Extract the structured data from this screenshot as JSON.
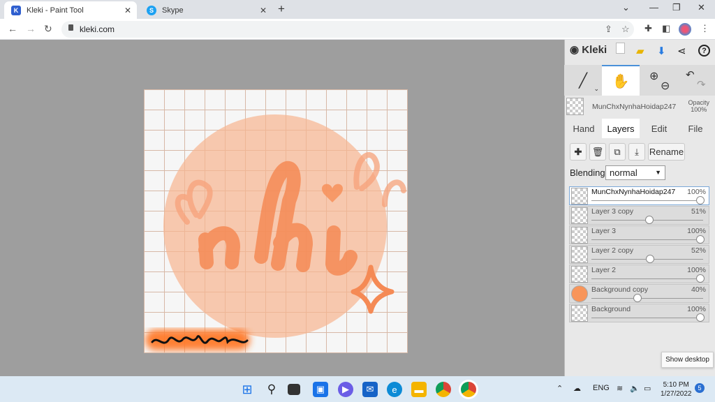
{
  "browser": {
    "tabs": [
      {
        "title": "Kleki - Paint Tool",
        "active": true
      },
      {
        "title": "Skype",
        "active": false
      }
    ],
    "url": "kleki.com"
  },
  "app": {
    "logo": "Kleki",
    "current_layer": {
      "name": "MunChxNynhaHoidap247",
      "opacity_label": "Opacity",
      "opacity": "100%"
    },
    "tabs": [
      "Hand",
      "Layers",
      "Edit",
      "File"
    ],
    "rename_label": "Rename",
    "blending": {
      "label": "Blending",
      "value": "normal"
    },
    "layers": [
      {
        "name": "MunChxNynhaHoidap247",
        "opacity": "100%",
        "value": 1.0,
        "selected": true
      },
      {
        "name": "Layer 3 copy",
        "opacity": "51%",
        "value": 0.51
      },
      {
        "name": "Layer 3",
        "opacity": "100%",
        "value": 1.0
      },
      {
        "name": "Layer 2 copy",
        "opacity": "52%",
        "value": 0.52
      },
      {
        "name": "Layer 2",
        "opacity": "100%",
        "value": 1.0
      },
      {
        "name": "Background copy",
        "opacity": "40%",
        "value": 0.4
      },
      {
        "name": "Background",
        "opacity": "100%",
        "value": 1.0
      }
    ]
  },
  "system": {
    "show_desktop": "Show desktop",
    "lang": "ENG",
    "time": "5:10 PM",
    "date": "1/27/2022",
    "notifications": "5"
  },
  "colors": {
    "accent": "#4a90d9",
    "peach": "#f8a070",
    "orange": "#ff7a2a"
  }
}
